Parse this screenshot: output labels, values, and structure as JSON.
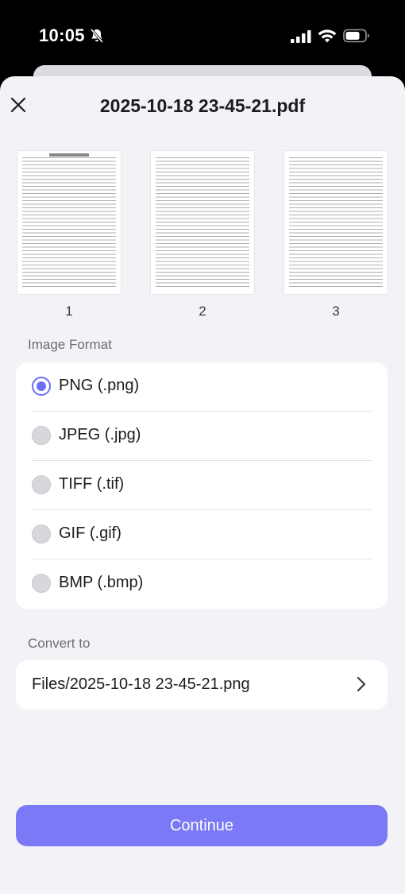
{
  "status": {
    "time": "10:05"
  },
  "header": {
    "title": "2025-10-18 23-45-21.pdf"
  },
  "pages": [
    {
      "number": "1"
    },
    {
      "number": "2"
    },
    {
      "number": "3"
    }
  ],
  "image_format": {
    "label": "Image Format",
    "options": [
      {
        "label": "PNG (.png)",
        "selected": true
      },
      {
        "label": "JPEG (.jpg)",
        "selected": false
      },
      {
        "label": "TIFF (.tif)",
        "selected": false
      },
      {
        "label": "GIF (.gif)",
        "selected": false
      },
      {
        "label": "BMP (.bmp)",
        "selected": false
      }
    ]
  },
  "convert_to": {
    "label": "Convert to",
    "path": "Files/2025-10-18 23-45-21.png"
  },
  "continue_label": "Continue",
  "colors": {
    "accent": "#7b79f5",
    "radio_selected": "#6c6cf7",
    "background": "#f2f2f7"
  }
}
